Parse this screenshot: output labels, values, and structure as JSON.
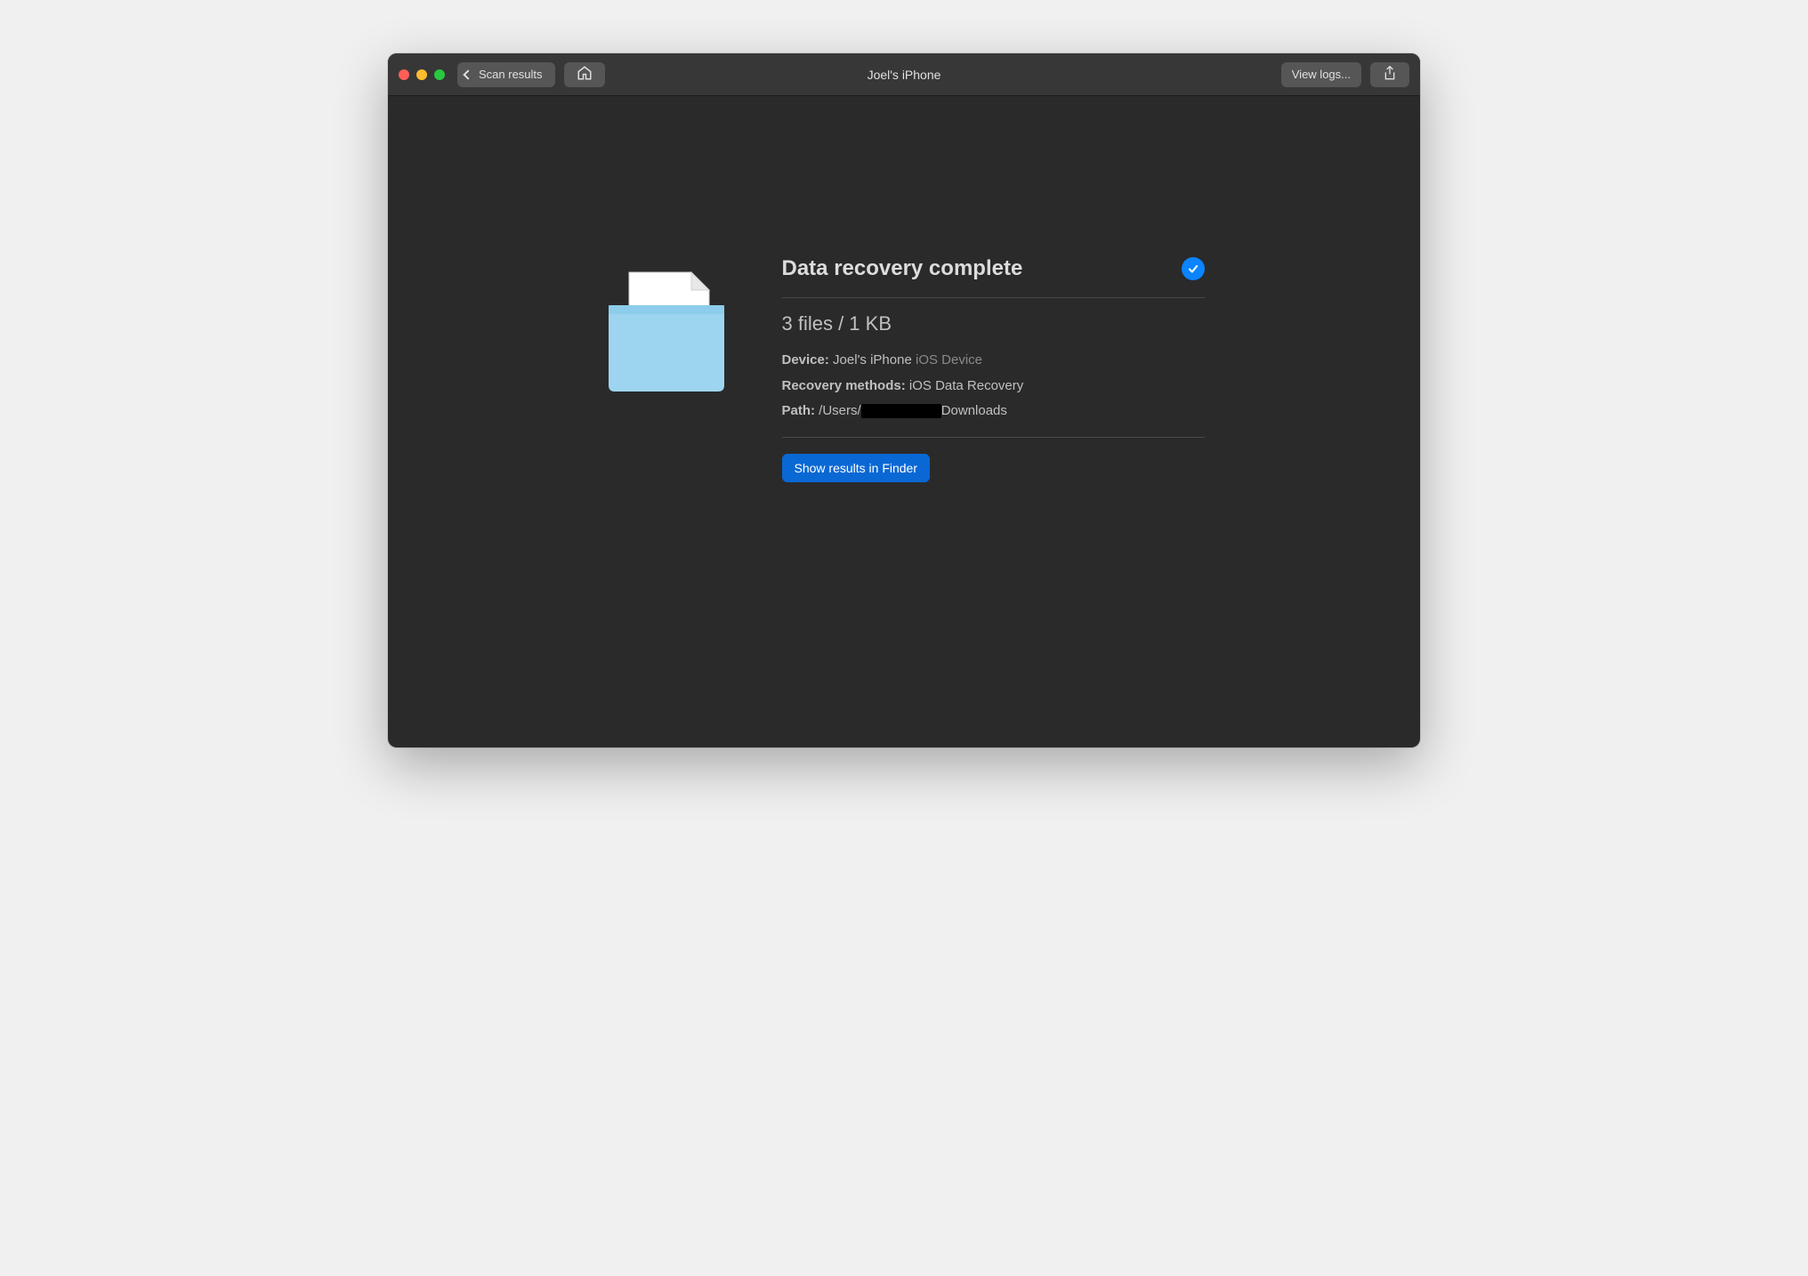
{
  "titlebar": {
    "back_label": "Scan results",
    "title": "Joel's iPhone",
    "view_logs": "View logs..."
  },
  "result": {
    "heading": "Data recovery complete",
    "summary": "3 files / 1 KB",
    "device_label": "Device:",
    "device_name": "Joel's iPhone",
    "device_type": "iOS Device",
    "methods_label": "Recovery methods:",
    "methods_value": "iOS Data Recovery",
    "path_label": "Path:",
    "path_prefix": "/Users/",
    "path_suffix": "Downloads",
    "finder_button": "Show results in Finder"
  }
}
